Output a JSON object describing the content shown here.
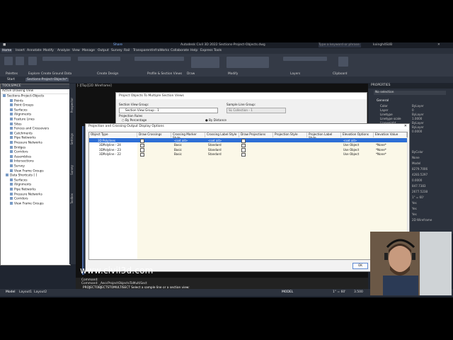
{
  "window": {
    "title": "Autodesk Civil 3D 2022   Sections-Project-Objects.dwg",
    "share": "Share",
    "search_placeholder": "Type a keyword or phrase",
    "user": "kxingh4SUB"
  },
  "ribbon_tabs": [
    "Home",
    "Insert",
    "Annotate",
    "Modify",
    "Analyze",
    "View",
    "Manage",
    "Output",
    "Survey",
    "Rail",
    "Transparent",
    "InfraWorks",
    "Collaborate",
    "Help",
    "Express Tools"
  ],
  "ribbon_groups": [
    "Palettes",
    "Explore",
    "Create Ground Data",
    "Create Design",
    "Profile & Section Views",
    "Draw",
    "Modify",
    "Layers",
    "Clipboard"
  ],
  "doc_tabs": [
    "Start",
    "Sections-Project-Objects*"
  ],
  "viewport_label": "[-][Top][2D Wireframe]",
  "toolspace": {
    "title": "TOOLSPACE",
    "subtitle": "Active Drawing View",
    "items": [
      "Sections-Project-Objects",
      "Points",
      "Point Groups",
      "Surfaces",
      "Alignments",
      "Feature Lines",
      "Sites",
      "Fences and Crossovers",
      "Catchments",
      "Pipe Networks",
      "Pressure Networks",
      "Bridges",
      "Corridors",
      "Assemblies",
      "Intersections",
      "Survey",
      "View Frame Groups",
      "Data Shortcuts [ ]",
      "Surfaces",
      "Alignments",
      "Pipe Networks",
      "Pressure Networks",
      "Corridors",
      "View Frame Groups"
    ],
    "side_tabs": [
      "Prospector",
      "Settings",
      "Survey",
      "Toolbox"
    ]
  },
  "back_dialog": {
    "title": "Project Objects To Multiple Section Views",
    "section_view_group_label": "Section View Group:",
    "section_view_group_value": "Section View Group - 1",
    "sample_line_group_label": "Sample Line Group:",
    "sample_line_group_value": "SL Collection - 1",
    "projection_rules_label": "Projection Rules",
    "rule_percentage": "By Percentage",
    "rule_distance": "By Distance"
  },
  "dialog": {
    "title": "Projection and Crossing Output Display Options",
    "columns": [
      "Object Type",
      "Draw Crossings",
      "Crossing Marker Style",
      "Crossing Label Style",
      "Draw Projections",
      "Projection Style",
      "Projection Label Style",
      "Elevation Options",
      "Elevation Value"
    ],
    "rows": [
      {
        "type": "3D Polylines",
        "marker": "<set all>",
        "label": "<set all>",
        "elev_opt": "<set all>",
        "elev_val": ""
      },
      {
        "type": "3DPolyline - 24",
        "marker": "Basic",
        "label": "Standard",
        "elev_opt": "Use Object",
        "elev_val": "*None*"
      },
      {
        "type": "3DPolyline - 23",
        "marker": "Basic",
        "label": "Standard",
        "elev_opt": "Use Object",
        "elev_val": "*None*"
      },
      {
        "type": "3DPolyline - 22",
        "marker": "Basic",
        "label": "Standard",
        "elev_opt": "Use Object",
        "elev_val": "*None*"
      }
    ],
    "ok": "OK"
  },
  "properties": {
    "title": "PROPERTIES",
    "selection": "No selection",
    "section": "General",
    "rows": [
      {
        "k": "Color",
        "v": "ByLayer"
      },
      {
        "k": "Layer",
        "v": "0"
      },
      {
        "k": "Linetype",
        "v": "ByLayer"
      },
      {
        "k": "Linetype scale",
        "v": "1.0000"
      },
      {
        "k": "Lineweight",
        "v": "ByLayer"
      },
      {
        "k": "Transparency",
        "v": "ByLayer"
      },
      {
        "k": "Thickness",
        "v": "0.0000"
      }
    ],
    "extra": [
      "ByColor",
      "None",
      "Model",
      "8279.7006",
      "4283.5297",
      "0.0000",
      "847.7383",
      "2677.5238",
      "1\" = 60'",
      "Yes",
      "Yes",
      "Yes",
      "2D Wireframe"
    ]
  },
  "command": {
    "line1": "Command:",
    "line2": "Command: _AeccProjectObjectsToMultiSect",
    "prompt": "PROJECTOBJECTSTOMULTISECT Select a sample line or a section view:"
  },
  "status": {
    "tabs": [
      "Model",
      "Layout1",
      "Layout2"
    ],
    "mode": "MODEL",
    "scale": "1\" = 60'",
    "value": "3.500"
  },
  "watermark": "www.civil3d.com"
}
